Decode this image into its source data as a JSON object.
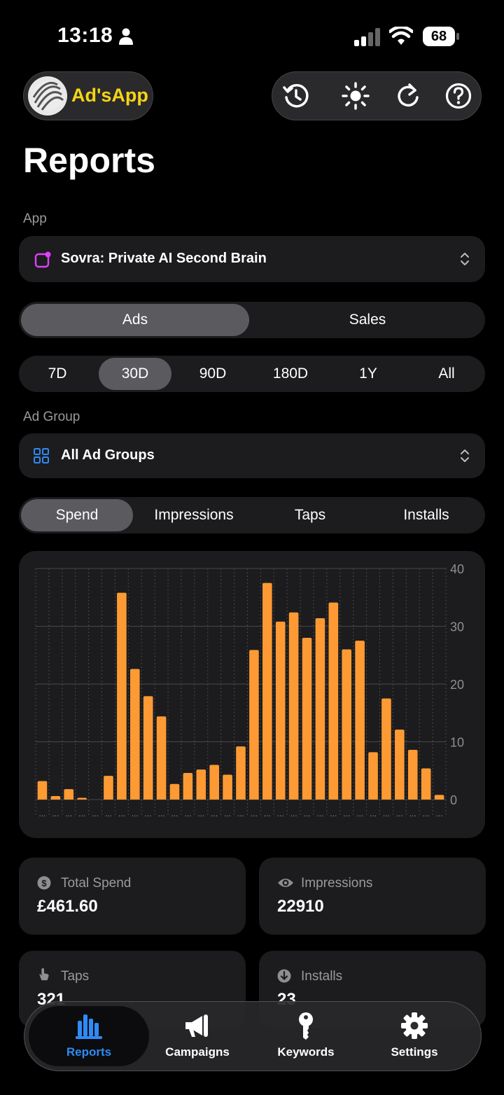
{
  "status": {
    "time": "13:18",
    "battery": "68"
  },
  "header": {
    "app_name": "Ad'sApp"
  },
  "page": {
    "title": "Reports"
  },
  "app_section": {
    "label": "App",
    "selected": "Sovra: Private AI Second Brain"
  },
  "mode_tabs": {
    "ads": "Ads",
    "sales": "Sales",
    "active": "Ads"
  },
  "range_tabs": {
    "items": [
      "7D",
      "30D",
      "90D",
      "180D",
      "1Y",
      "All"
    ],
    "active": "30D"
  },
  "ad_group_section": {
    "label": "Ad Group",
    "selected": "All Ad Groups"
  },
  "metric_tabs": {
    "items": [
      "Spend",
      "Impressions",
      "Taps",
      "Installs"
    ],
    "active": "Spend"
  },
  "chart_data": {
    "type": "bar",
    "values": [
      3.2,
      0.6,
      1.8,
      0.3,
      0,
      4.1,
      35.8,
      22.6,
      17.9,
      14.4,
      2.7,
      4.6,
      5.2,
      6,
      4.3,
      9.2,
      25.9,
      37.5,
      30.8,
      32.4,
      28,
      31.4,
      34.1,
      26,
      27.5,
      8.2,
      17.5,
      12.1,
      8.6,
      5.4,
      0.8
    ],
    "ylim": [
      0,
      40
    ],
    "yticks": [
      "40",
      "30",
      "20",
      "10",
      "0"
    ],
    "color": "#fd9a33",
    "grid": true
  },
  "stats": {
    "total_spend": {
      "label": "Total Spend",
      "value": "£461.60"
    },
    "impressions": {
      "label": "Impressions",
      "value": "22910"
    },
    "taps": {
      "label": "Taps",
      "value": "321"
    },
    "installs": {
      "label": "Installs",
      "value": "23"
    }
  },
  "tabbar": {
    "reports": "Reports",
    "campaigns": "Campaigns",
    "keywords": "Keywords",
    "settings": "Settings",
    "active_color": "#2f8bf5"
  }
}
